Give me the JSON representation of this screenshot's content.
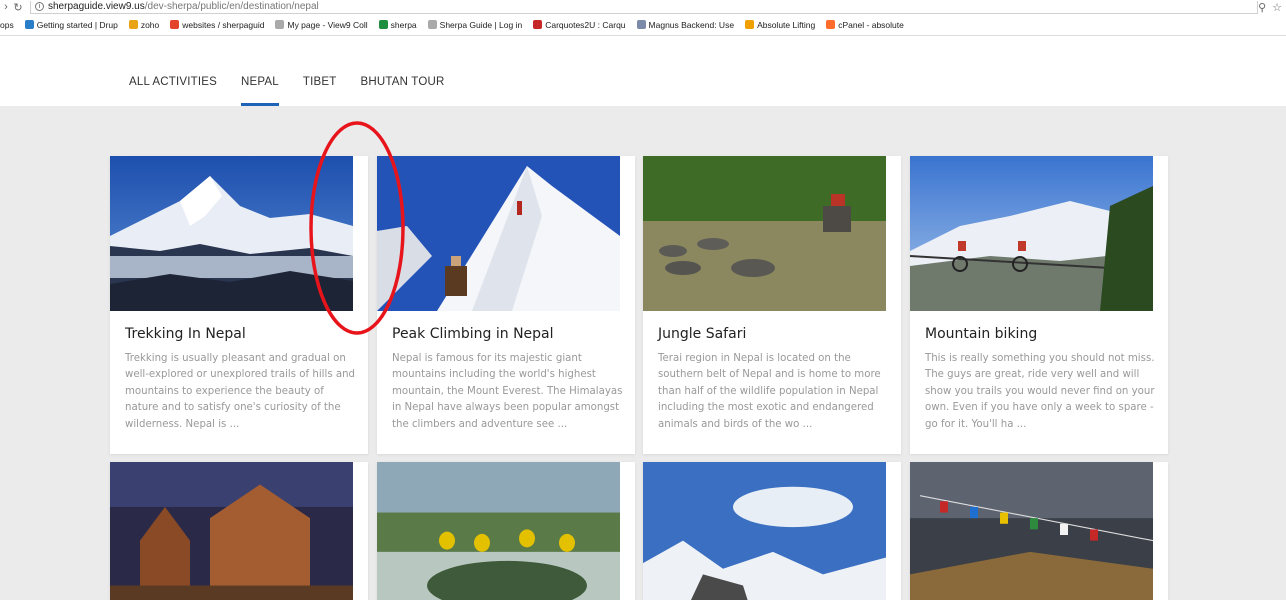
{
  "browser": {
    "url_host": "sherpaguide.view9.us",
    "url_path": "/dev-sherpa/public/en/destination/nepal",
    "bookmarks": [
      {
        "label": "ops",
        "color": "#ffffff"
      },
      {
        "label": "Getting started | Drup",
        "color": "#2a7ec7"
      },
      {
        "label": "zoho",
        "color": "#e8a317"
      },
      {
        "label": "websites / sherpaguid",
        "color": "#e24329"
      },
      {
        "label": "My page - View9 Coll",
        "color": "#aaaaaa"
      },
      {
        "label": "sherpa",
        "color": "#1e8e3e"
      },
      {
        "label": "Sherpa Guide | Log in",
        "color": "#aaaaaa"
      },
      {
        "label": "Carquotes2U : Carqu",
        "color": "#c62828"
      },
      {
        "label": "Magnus Backend: Use",
        "color": "#7a8aa8"
      },
      {
        "label": "Absolute Lifting",
        "color": "#f0a000"
      },
      {
        "label": "cPanel - absolute",
        "color": "#ff6c2c"
      }
    ]
  },
  "nav": {
    "tabs": [
      {
        "label": "ALL ACTIVITIES",
        "active": false
      },
      {
        "label": "NEPAL",
        "active": true
      },
      {
        "label": "TIBET",
        "active": false
      },
      {
        "label": "BHUTAN TOUR",
        "active": false
      }
    ],
    "accent": "#1d64b9"
  },
  "cards": [
    {
      "title": "Trekking In Nepal",
      "description": "Trekking is usually pleasant and gradual on well-explored or unexplored trails of hills and mountains to experience the beauty of nature and to satisfy one's curiosity of the wilderness. Nepal is ..."
    },
    {
      "title": "Peak Climbing in Nepal",
      "description": "Nepal is famous for its majestic giant mountains including the world's highest mountain, the Mount Everest. The Himalayas in Nepal have always been popular amongst the climbers and adventure see ..."
    },
    {
      "title": "Jungle Safari",
      "description": "Terai region in Nepal is located on the southern belt of Nepal and is home to more than half of the wildlife population in Nepal including the most exotic and endangered animals and birds of the wo ..."
    },
    {
      "title": "Mountain biking",
      "description": "This is really something you should not miss. The guys are great, ride very well and will show you trails you would never find on your own. Even if you have only a week to spare - go for it. You'll ha ..."
    }
  ],
  "annotation_color": "#e8141b"
}
